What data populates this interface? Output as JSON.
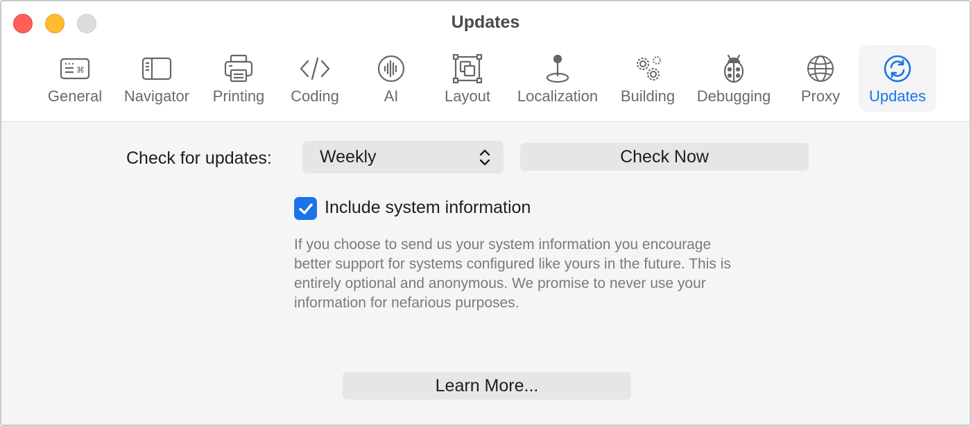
{
  "window": {
    "title": "Updates"
  },
  "toolbar": {
    "tabs": [
      {
        "label": "General",
        "icon": "keyboard-icon"
      },
      {
        "label": "Navigator",
        "icon": "sidebar-icon"
      },
      {
        "label": "Printing",
        "icon": "printer-icon"
      },
      {
        "label": "Coding",
        "icon": "code-brackets-icon"
      },
      {
        "label": "AI",
        "icon": "waveform-icon"
      },
      {
        "label": "Layout",
        "icon": "layout-icon"
      },
      {
        "label": "Localization",
        "icon": "location-pin-icon"
      },
      {
        "label": "Building",
        "icon": "gears-icon"
      },
      {
        "label": "Debugging",
        "icon": "ladybug-icon"
      },
      {
        "label": "Proxy",
        "icon": "globe-icon"
      },
      {
        "label": "Updates",
        "icon": "refresh-icon",
        "active": true
      }
    ]
  },
  "updates": {
    "check_label": "Check for updates:",
    "frequency_value": "Weekly",
    "check_now_label": "Check Now",
    "include_system_info_label": "Include system information",
    "include_system_info_checked": true,
    "description": "If you choose to send us your system information you encourage better support for systems configured like yours in the future. This is entirely optional and anonymous. We promise to never use your information for nefarious purposes.",
    "learn_more_label": "Learn More..."
  },
  "colors": {
    "accent": "#1a73e8",
    "close": "#ff5f57",
    "minimize": "#febc2e",
    "zoom": "#dcdcdc"
  }
}
